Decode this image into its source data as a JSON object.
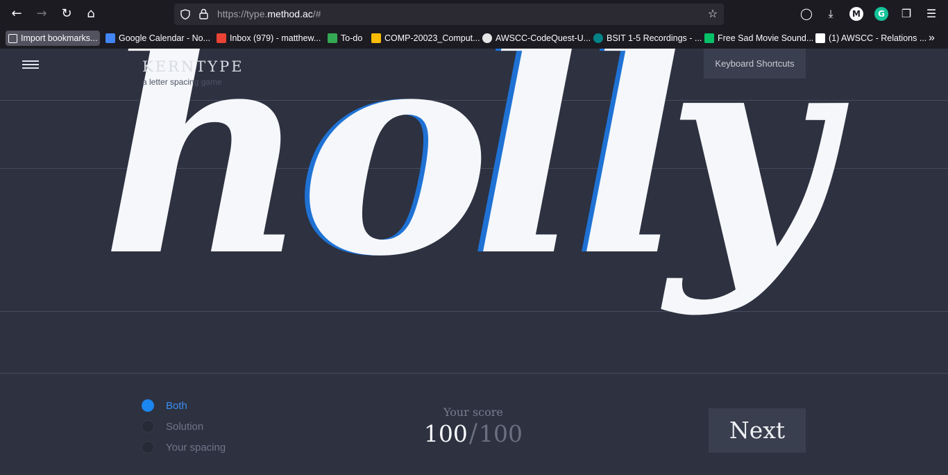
{
  "browser": {
    "url_prefix": "https://type.",
    "url_domain": "method.ac",
    "url_suffix": "/#",
    "bookmarks": [
      {
        "label": "Import bookmarks...",
        "color": "#fbfbfe",
        "icon": "import-icon"
      },
      {
        "label": "Google Calendar - No...",
        "color": "#4285f4",
        "icon": "google-calendar-icon"
      },
      {
        "label": "Inbox (979) - matthew...",
        "color": "#ea4335",
        "icon": "gmail-icon"
      },
      {
        "label": "To-do",
        "color": "#34a853",
        "icon": "classroom-icon"
      },
      {
        "label": "COMP-20023_Comput...",
        "color": "#fbbc04",
        "icon": "google-drive-icon"
      },
      {
        "label": "AWSCC-CodeQuest-U...",
        "color": "#e6e6e6",
        "icon": "github-icon"
      },
      {
        "label": "BSIT 1-5 Recordings - ...",
        "color": "#038387",
        "icon": "sharepoint-icon"
      },
      {
        "label": "Free Sad Movie Sound...",
        "color": "#06c167",
        "icon": "pixabay-icon"
      },
      {
        "label": "(1) AWSCC - Relations ...",
        "color": "#ffffff",
        "icon": "notion-icon"
      }
    ]
  },
  "app": {
    "logo": "KERNTYPE",
    "tagline": "a letter spacing game",
    "keyboard_shortcuts": "Keyboard Shortcuts",
    "word": [
      "h",
      "o",
      "l",
      "l",
      "y"
    ],
    "options": [
      {
        "label": "Both",
        "selected": true
      },
      {
        "label": "Solution",
        "selected": false
      },
      {
        "label": "Your spacing",
        "selected": false
      }
    ],
    "score_label": "Your score",
    "score": "100",
    "score_sep": "/",
    "score_max": "100",
    "next_label": "Next",
    "colors": {
      "accent": "#1b85f0",
      "background": "#2d3140",
      "letter": "#f5f7fa"
    }
  }
}
